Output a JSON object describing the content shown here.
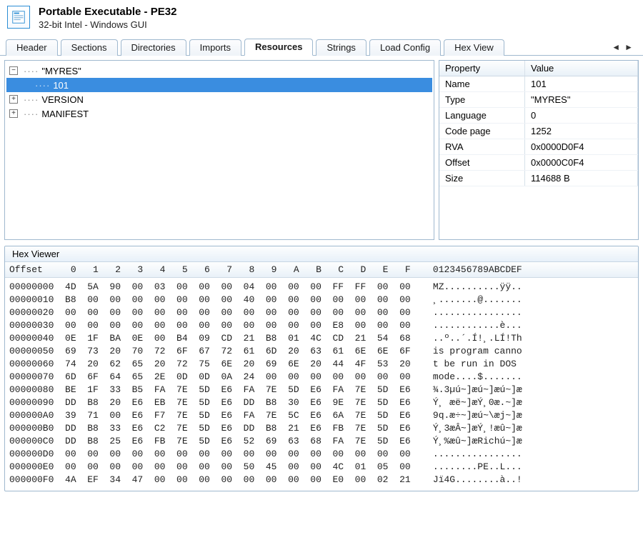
{
  "header": {
    "title": "Portable Executable - PE32",
    "subtitle": "32-bit Intel - Windows GUI"
  },
  "tabs": [
    {
      "label": "Header",
      "active": false
    },
    {
      "label": "Sections",
      "active": false
    },
    {
      "label": "Directories",
      "active": false
    },
    {
      "label": "Imports",
      "active": false
    },
    {
      "label": "Resources",
      "active": true
    },
    {
      "label": "Strings",
      "active": false
    },
    {
      "label": "Load Config",
      "active": false
    },
    {
      "label": "Hex View",
      "active": false
    }
  ],
  "tree": {
    "nodes": [
      {
        "toggle": "−",
        "label": "\"MYRES\"",
        "level": 0,
        "selected": false
      },
      {
        "toggle": "",
        "label": "101",
        "level": 1,
        "selected": true
      },
      {
        "toggle": "+",
        "label": "VERSION",
        "level": 0,
        "selected": false
      },
      {
        "toggle": "+",
        "label": "MANIFEST",
        "level": 0,
        "selected": false
      }
    ]
  },
  "properties": {
    "header": {
      "col1": "Property",
      "col2": "Value"
    },
    "rows": [
      {
        "k": "Name",
        "v": "101"
      },
      {
        "k": "Type",
        "v": "\"MYRES\""
      },
      {
        "k": "Language",
        "v": "0"
      },
      {
        "k": "Code page",
        "v": "1252"
      },
      {
        "k": "RVA",
        "v": "0x0000D0F4"
      },
      {
        "k": "Offset",
        "v": "0x0000C0F4"
      },
      {
        "k": "Size",
        "v": "114688 B"
      }
    ]
  },
  "hex": {
    "title": "Hex Viewer",
    "header_offset": "Offset",
    "cols": [
      "0",
      "1",
      "2",
      "3",
      "4",
      "5",
      "6",
      "7",
      "8",
      "9",
      "A",
      "B",
      "C",
      "D",
      "E",
      "F"
    ],
    "ascii_header": "0123456789ABCDEF",
    "rows": [
      {
        "o": "00000000",
        "b": [
          "4D",
          "5A",
          "90",
          "00",
          "03",
          "00",
          "00",
          "00",
          "04",
          "00",
          "00",
          "00",
          "FF",
          "FF",
          "00",
          "00"
        ],
        "a": "MZ..........ÿÿ.."
      },
      {
        "o": "00000010",
        "b": [
          "B8",
          "00",
          "00",
          "00",
          "00",
          "00",
          "00",
          "00",
          "40",
          "00",
          "00",
          "00",
          "00",
          "00",
          "00",
          "00"
        ],
        "a": "¸.......@......."
      },
      {
        "o": "00000020",
        "b": [
          "00",
          "00",
          "00",
          "00",
          "00",
          "00",
          "00",
          "00",
          "00",
          "00",
          "00",
          "00",
          "00",
          "00",
          "00",
          "00"
        ],
        "a": "................"
      },
      {
        "o": "00000030",
        "b": [
          "00",
          "00",
          "00",
          "00",
          "00",
          "00",
          "00",
          "00",
          "00",
          "00",
          "00",
          "00",
          "E8",
          "00",
          "00",
          "00"
        ],
        "a": "............è..."
      },
      {
        "o": "00000040",
        "b": [
          "0E",
          "1F",
          "BA",
          "0E",
          "00",
          "B4",
          "09",
          "CD",
          "21",
          "B8",
          "01",
          "4C",
          "CD",
          "21",
          "54",
          "68"
        ],
        "a": "..º..´.Í!¸.LÍ!Th"
      },
      {
        "o": "00000050",
        "b": [
          "69",
          "73",
          "20",
          "70",
          "72",
          "6F",
          "67",
          "72",
          "61",
          "6D",
          "20",
          "63",
          "61",
          "6E",
          "6E",
          "6F"
        ],
        "a": "is program canno"
      },
      {
        "o": "00000060",
        "b": [
          "74",
          "20",
          "62",
          "65",
          "20",
          "72",
          "75",
          "6E",
          "20",
          "69",
          "6E",
          "20",
          "44",
          "4F",
          "53",
          "20"
        ],
        "a": "t be run in DOS "
      },
      {
        "o": "00000070",
        "b": [
          "6D",
          "6F",
          "64",
          "65",
          "2E",
          "0D",
          "0D",
          "0A",
          "24",
          "00",
          "00",
          "00",
          "00",
          "00",
          "00",
          "00"
        ],
        "a": "mode....$......."
      },
      {
        "o": "00000080",
        "b": [
          "BE",
          "1F",
          "33",
          "B5",
          "FA",
          "7E",
          "5D",
          "E6",
          "FA",
          "7E",
          "5D",
          "E6",
          "FA",
          "7E",
          "5D",
          "E6"
        ],
        "a": "¾.3µú~]æú~]æú~]æ"
      },
      {
        "o": "00000090",
        "b": [
          "DD",
          "B8",
          "20",
          "E6",
          "EB",
          "7E",
          "5D",
          "E6",
          "DD",
          "B8",
          "30",
          "E6",
          "9E",
          "7E",
          "5D",
          "E6"
        ],
        "a": "Ý¸ æë~]æÝ¸0æ.~]æ"
      },
      {
        "o": "000000A0",
        "b": [
          "39",
          "71",
          "00",
          "E6",
          "F7",
          "7E",
          "5D",
          "E6",
          "FA",
          "7E",
          "5C",
          "E6",
          "6A",
          "7E",
          "5D",
          "E6"
        ],
        "a": "9q.æ÷~]æú~\\æj~]æ"
      },
      {
        "o": "000000B0",
        "b": [
          "DD",
          "B8",
          "33",
          "E6",
          "C2",
          "7E",
          "5D",
          "E6",
          "DD",
          "B8",
          "21",
          "E6",
          "FB",
          "7E",
          "5D",
          "E6"
        ],
        "a": "Ý¸3æÂ~]æÝ¸!æû~]æ"
      },
      {
        "o": "000000C0",
        "b": [
          "DD",
          "B8",
          "25",
          "E6",
          "FB",
          "7E",
          "5D",
          "E6",
          "52",
          "69",
          "63",
          "68",
          "FA",
          "7E",
          "5D",
          "E6"
        ],
        "a": "Ý¸%æû~]æRichú~]æ"
      },
      {
        "o": "000000D0",
        "b": [
          "00",
          "00",
          "00",
          "00",
          "00",
          "00",
          "00",
          "00",
          "00",
          "00",
          "00",
          "00",
          "00",
          "00",
          "00",
          "00"
        ],
        "a": "................"
      },
      {
        "o": "000000E0",
        "b": [
          "00",
          "00",
          "00",
          "00",
          "00",
          "00",
          "00",
          "00",
          "50",
          "45",
          "00",
          "00",
          "4C",
          "01",
          "05",
          "00"
        ],
        "a": "........PE..L..."
      },
      {
        "o": "000000F0",
        "b": [
          "4A",
          "EF",
          "34",
          "47",
          "00",
          "00",
          "00",
          "00",
          "00",
          "00",
          "00",
          "00",
          "E0",
          "00",
          "02",
          "21"
        ],
        "a": "Jï4G........à..!"
      }
    ]
  }
}
